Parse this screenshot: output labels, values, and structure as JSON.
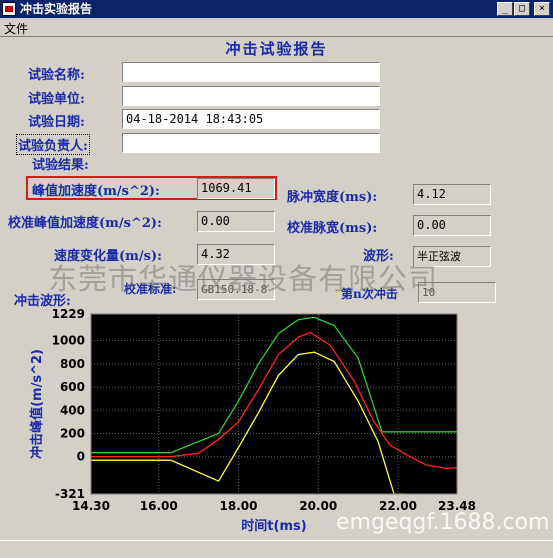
{
  "window": {
    "title": "冲击实验报告"
  },
  "menu": {
    "file": "文件"
  },
  "report": {
    "title": "冲击试验报告",
    "test_name_label": "试验名称:",
    "test_name": "",
    "test_unit_label": "试验单位:",
    "test_unit": "",
    "test_date_label": "试验日期:",
    "test_date": "04-18-2014   18:43:05",
    "responsible_label": "试验负责人:",
    "responsible": "",
    "result_label": "试验结果:"
  },
  "results": {
    "peak_accel_label": "峰值加速度(m/s^2):",
    "peak_accel": "1069.41",
    "pulse_width_label": "脉冲宽度(ms):",
    "pulse_width": "4.12",
    "cal_peak_label": "校准峰值加速度(m/s^2):",
    "cal_peak": "0.00",
    "cal_width_label": "校准脉宽(ms):",
    "cal_width": "0.00",
    "velocity_change_label": "速度变化量(m/s):",
    "velocity_change": "4.32",
    "waveform_label": "波形:",
    "waveform": "半正弦波",
    "standard_label": "校准标准:",
    "standard": "GB150.18-8",
    "shock_no_label": "第n次冲击",
    "shock_no": "10"
  },
  "chart_title": "冲击波形:",
  "watermark": "东莞市华通仪器设备有限公司",
  "watermark2": "emgeqgf.1688.com",
  "chart_data": {
    "type": "line",
    "xlabel": "时间t(ms)",
    "ylabel": "冲击峰值(m/s^2)",
    "xlim": [
      14.3,
      23.48
    ],
    "ylim": [
      -321,
      1229
    ],
    "x_ticks": [
      "14.30",
      "16.00",
      "18.00",
      "20.00",
      "22.00",
      "23.48"
    ],
    "y_ticks": [
      "1229",
      "1000",
      "800",
      "600",
      "400",
      "200",
      "0",
      "-321"
    ],
    "grid": true,
    "background": "#000000",
    "series": [
      {
        "color": "#33cc33",
        "x": [
          14.3,
          16.3,
          17.5,
          18.0,
          18.5,
          19.0,
          19.5,
          19.9,
          20.4,
          21.0,
          21.6,
          23.48
        ],
        "y": [
          35,
          35,
          200,
          480,
          800,
          1060,
          1180,
          1200,
          1130,
          850,
          215,
          215
        ]
      },
      {
        "color": "#ff2222",
        "x": [
          14.3,
          16.3,
          17.0,
          17.5,
          18.0,
          18.5,
          19.0,
          19.5,
          19.8,
          20.3,
          20.9,
          21.4,
          21.8,
          22.2,
          22.7,
          23.2,
          23.48
        ],
        "y": [
          0,
          0,
          30,
          150,
          300,
          580,
          880,
          1030,
          1070,
          960,
          650,
          300,
          100,
          20,
          -70,
          -100,
          -95
        ]
      },
      {
        "color": "#ffff33",
        "x": [
          14.3,
          16.3,
          17.5,
          18.0,
          18.5,
          19.0,
          19.5,
          19.9,
          20.4,
          21.0,
          21.5,
          21.9,
          22.2
        ],
        "y": [
          -30,
          -30,
          -210,
          80,
          380,
          700,
          880,
          900,
          820,
          480,
          130,
          -321,
          -321
        ]
      }
    ]
  }
}
